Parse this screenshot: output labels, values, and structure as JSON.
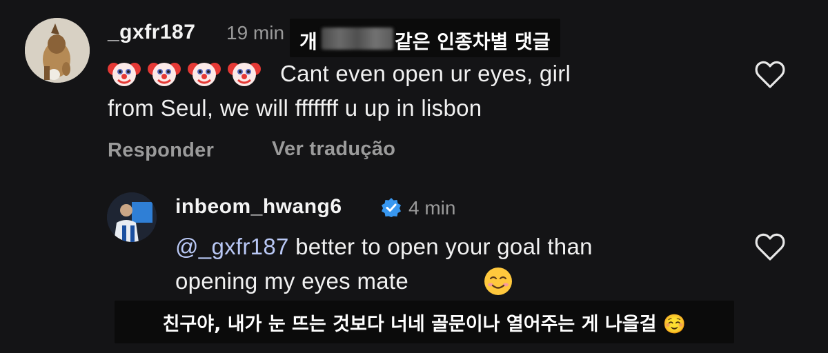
{
  "comments": [
    {
      "username": "_gxfr187",
      "time": "19 min",
      "emoji": "clown-face",
      "emoji_count": 4,
      "text_line1": "Cant even open ur eyes, girl",
      "text_line2": "from Seul, we will fffffff u up in lisbon",
      "reply_label": "Responder",
      "translate_label": "Ver tradução",
      "like_icon": "heart-outline-icon"
    },
    {
      "username": "inbeom_hwang6",
      "verified": true,
      "time": "4 min",
      "mention": "@_gxfr187",
      "text_line1_rest": " better to open your goal than",
      "text_line2": "opening my eyes mate",
      "emoji": "smiling-face",
      "like_icon": "heart-outline-icon"
    }
  ],
  "captions": {
    "top_before_blur": "개",
    "top_after_blur": "같은 인종차별 댓글",
    "bottom": "친구야, 내가 눈 뜨는 것보다 너네 골문이나 열어주는 게 나을걸 ☺️"
  },
  "colors": {
    "background": "#141416",
    "text": "#f1f1f1",
    "secondary": "#9b9b9b",
    "mention": "#b9c8f5",
    "verified": "#3897f0",
    "caption_bg": "#0b0b0b"
  }
}
